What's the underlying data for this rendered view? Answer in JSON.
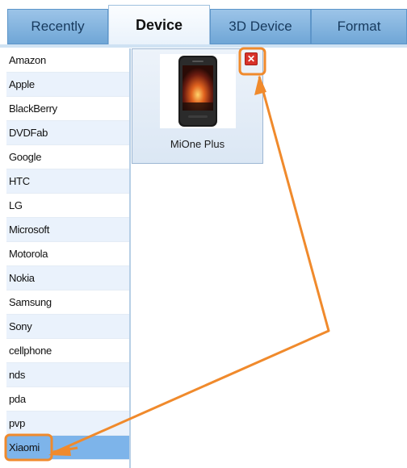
{
  "tabs": [
    {
      "label": "Recently"
    },
    {
      "label": "Device"
    },
    {
      "label": "3D Device"
    },
    {
      "label": "Format"
    }
  ],
  "selected_tab": "Device",
  "brands": [
    {
      "label": "Amazon"
    },
    {
      "label": "Apple"
    },
    {
      "label": "BlackBerry"
    },
    {
      "label": "DVDFab"
    },
    {
      "label": "Google"
    },
    {
      "label": "HTC"
    },
    {
      "label": "LG"
    },
    {
      "label": "Microsoft"
    },
    {
      "label": "Motorola"
    },
    {
      "label": "Nokia"
    },
    {
      "label": "Samsung"
    },
    {
      "label": "Sony"
    },
    {
      "label": "cellphone"
    },
    {
      "label": "nds"
    },
    {
      "label": "pda"
    },
    {
      "label": "pvp"
    },
    {
      "label": "Xiaomi"
    }
  ],
  "selected_brand": "Xiaomi",
  "device_card": {
    "name": "MiOne Plus",
    "delete_icon": "close-x-icon",
    "image_icon": "smartphone-icon"
  },
  "colors": {
    "accent_blue": "#7db4ea",
    "annotation_orange": "#f08a2c",
    "delete_red": "#d8332a"
  }
}
